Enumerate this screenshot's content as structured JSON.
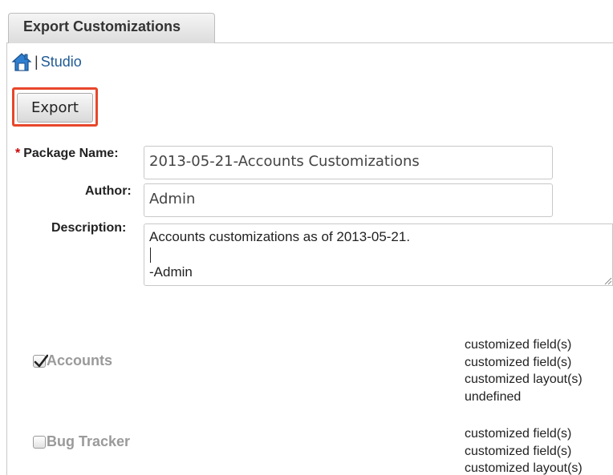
{
  "tab": {
    "label": "Export Customizations"
  },
  "breadcrumb": {
    "home_icon": "home-icon",
    "separator": "|",
    "studio_label": "Studio"
  },
  "actions": {
    "export_label": "Export",
    "highlight_color": "#e8462a"
  },
  "form": {
    "package_name": {
      "required_mark": "*",
      "label": "Package Name:",
      "value": "2013-05-21-Accounts Customizations"
    },
    "author": {
      "label": "Author:",
      "value": "Admin"
    },
    "description": {
      "label": "Description:",
      "line1": "Accounts customizations as of 2013-05-21.",
      "line3": "-Admin"
    }
  },
  "modules": [
    {
      "name": "Accounts",
      "checked": true,
      "details": [
        "customized field(s)",
        "customized field(s)",
        "customized layout(s)",
        "undefined"
      ]
    },
    {
      "name": "Bug Tracker",
      "checked": false,
      "details": [
        "customized field(s)",
        "customized field(s)",
        "customized layout(s)"
      ]
    }
  ]
}
